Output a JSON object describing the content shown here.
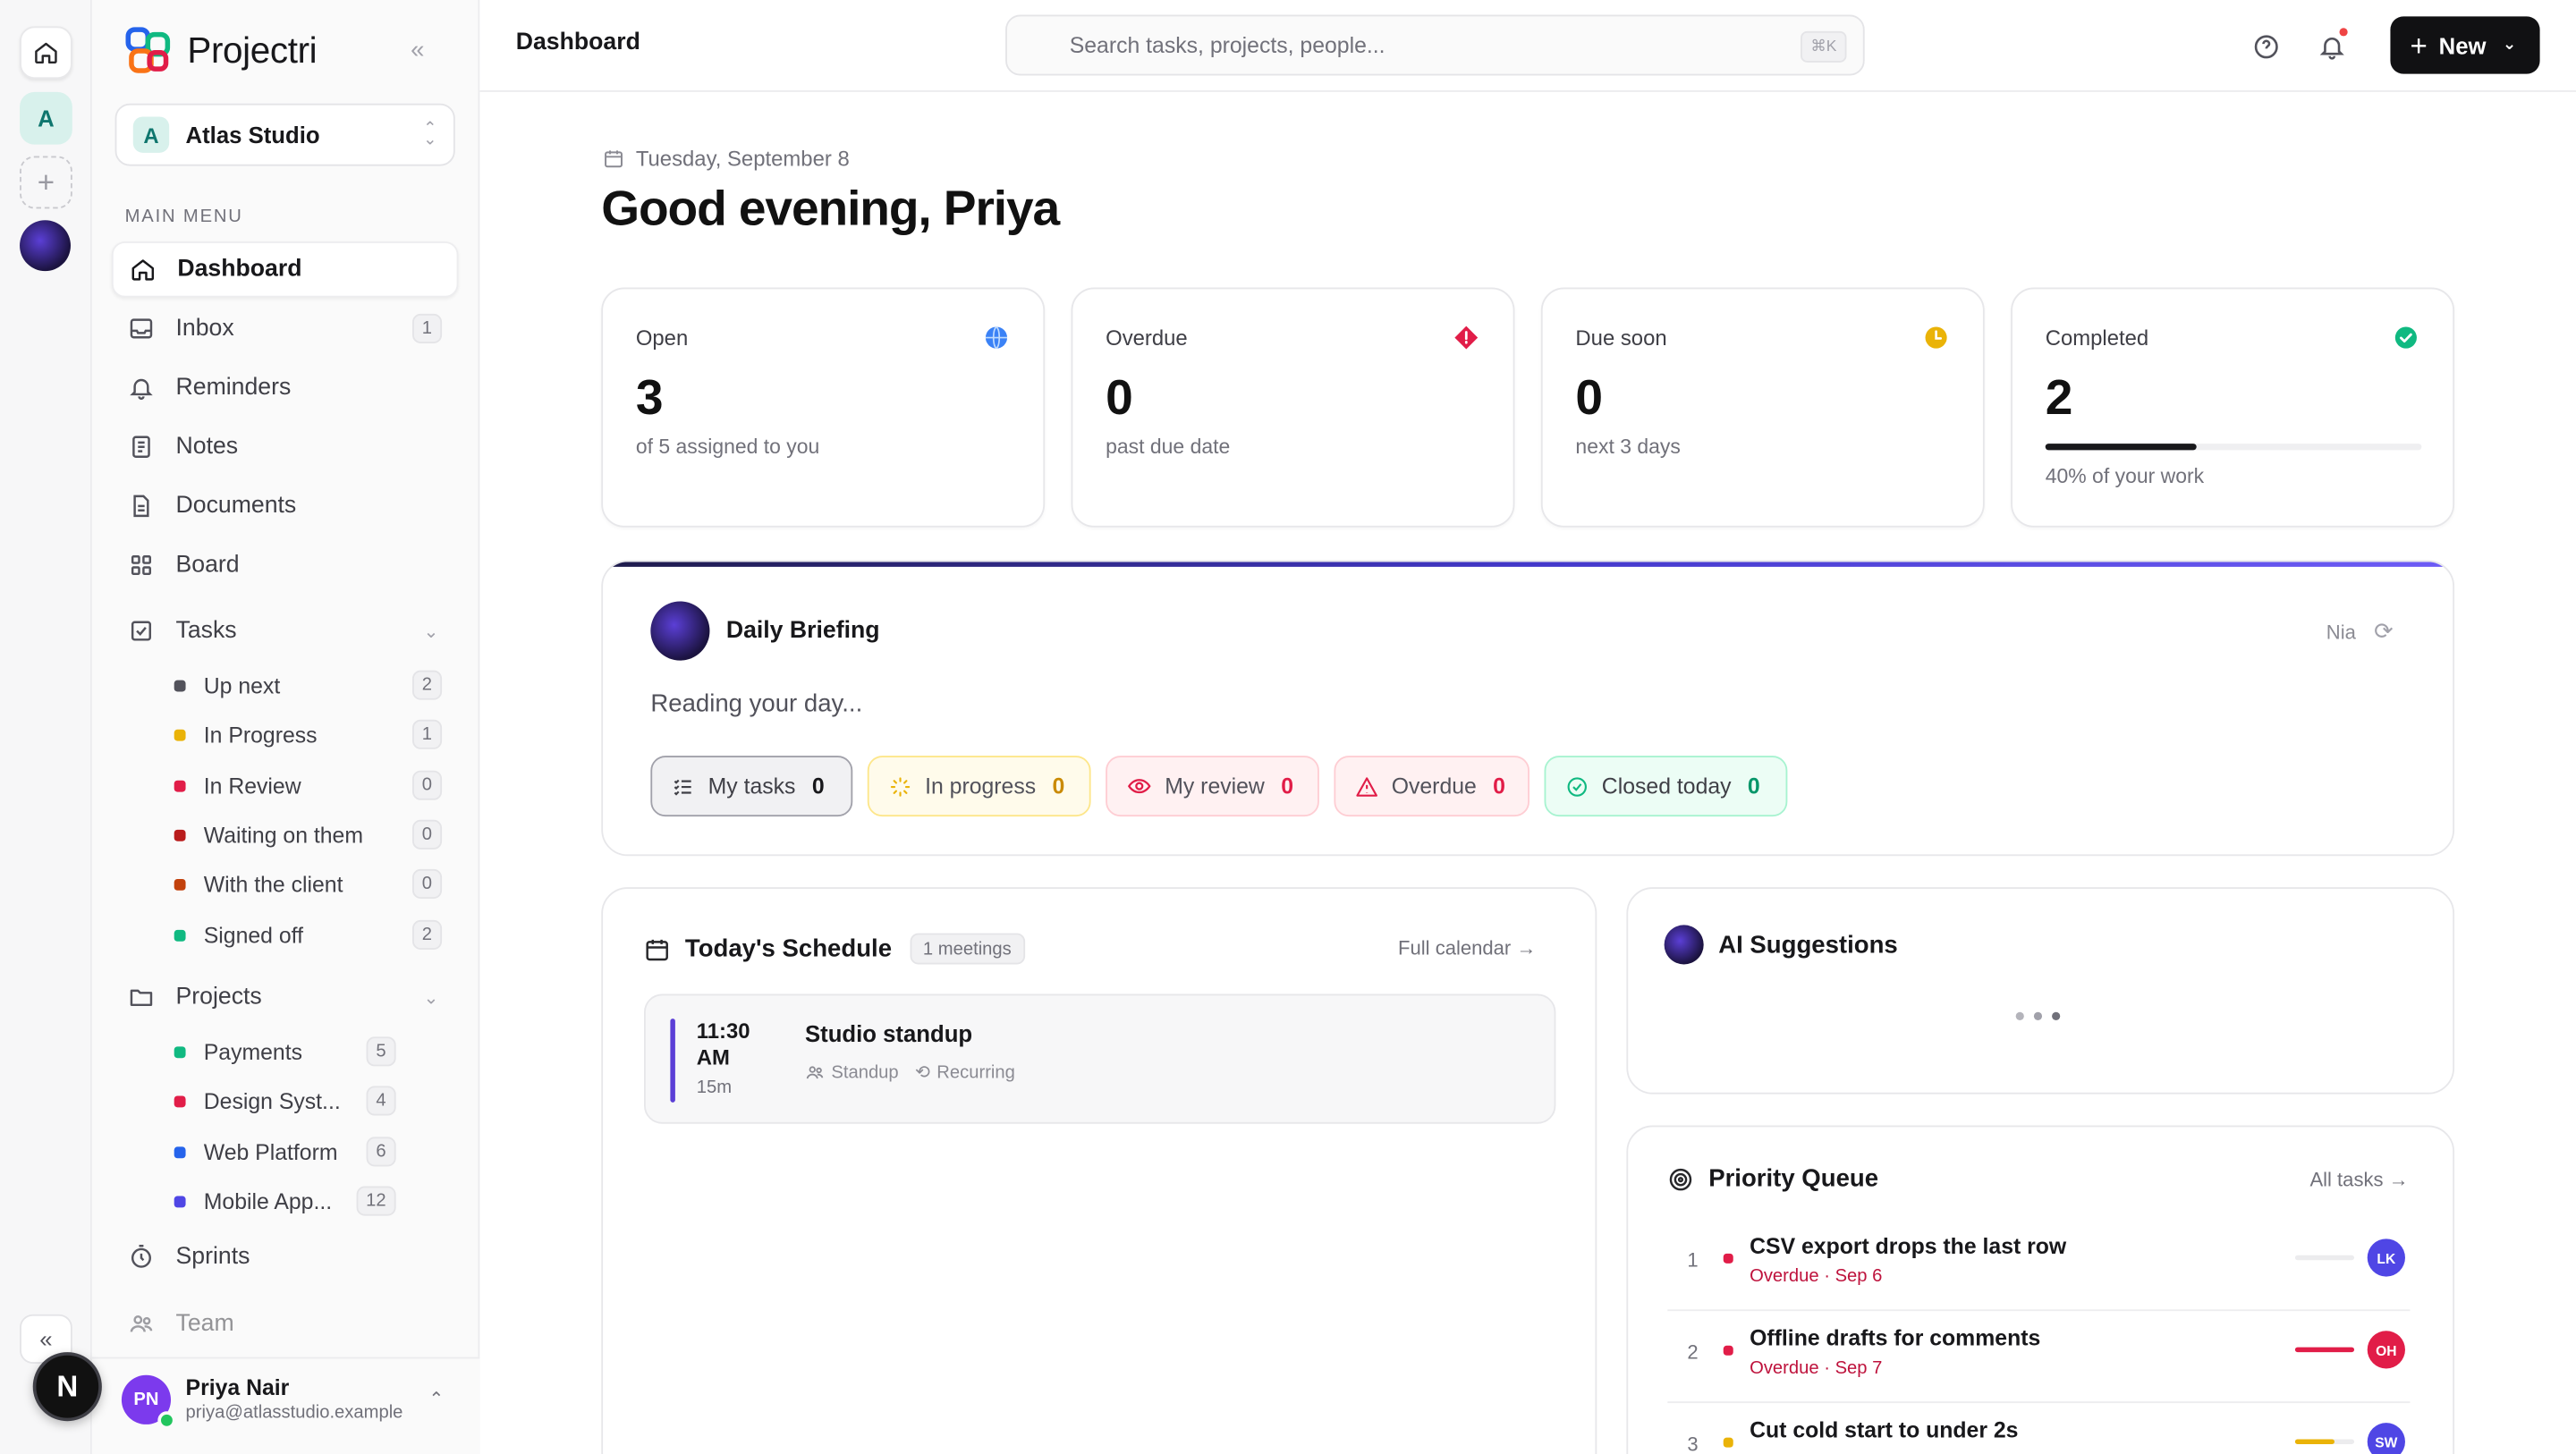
{
  "app": {
    "name": "Projectri"
  },
  "workspace": {
    "initial": "A",
    "name": "Atlas Studio"
  },
  "rail": {
    "workspace_initial": "A",
    "overlay_badge": "N"
  },
  "sidebar": {
    "section_label": "MAIN MENU",
    "items": [
      {
        "label": "Dashboard",
        "icon": "home-icon"
      },
      {
        "label": "Inbox",
        "icon": "inbox-icon",
        "count": "1"
      },
      {
        "label": "Reminders",
        "icon": "bell-icon"
      },
      {
        "label": "Notes",
        "icon": "notes-icon"
      },
      {
        "label": "Documents",
        "icon": "document-icon"
      },
      {
        "label": "Board",
        "icon": "board-icon"
      },
      {
        "label": "Tasks",
        "icon": "checkbox-icon"
      }
    ],
    "task_views": [
      {
        "label": "Up next",
        "count": "2",
        "color": "#52525b"
      },
      {
        "label": "In Progress",
        "count": "1",
        "color": "#eab308"
      },
      {
        "label": "In Review",
        "count": "0",
        "color": "#e11d48"
      },
      {
        "label": "Waiting on them",
        "count": "0",
        "color": "#b91c1c"
      },
      {
        "label": "With the client",
        "count": "0",
        "color": "#c2410c"
      },
      {
        "label": "Signed off",
        "count": "2",
        "color": "#10b981"
      }
    ],
    "projects_label": "Projects",
    "projects": [
      {
        "label": "Payments",
        "count": "5",
        "color": "#10b981"
      },
      {
        "label": "Design Syst...",
        "count": "4",
        "color": "#e11d48"
      },
      {
        "label": "Web Platform",
        "count": "6",
        "color": "#2563eb"
      },
      {
        "label": "Mobile App...",
        "count": "12",
        "color": "#4f46e5"
      }
    ],
    "sprints_label": "Sprints",
    "team_label": "Team"
  },
  "user": {
    "initials": "PN",
    "name": "Priya Nair",
    "email": "priya@atlasstudio.example"
  },
  "topbar": {
    "breadcrumb": "Dashboard",
    "search_placeholder": "Search tasks, projects, people...",
    "search_shortcut": "⌘K",
    "new_label": "New"
  },
  "header": {
    "date": "Tuesday, September 8",
    "greeting": "Good evening, Priya"
  },
  "stats": [
    {
      "label": "Open",
      "value": "3",
      "sub": "of 5 assigned to you",
      "color": "#3b82f6"
    },
    {
      "label": "Overdue",
      "value": "0",
      "sub": "past due date",
      "color": "#e11d48"
    },
    {
      "label": "Due soon",
      "value": "0",
      "sub": "next 3 days",
      "color": "#eab308"
    },
    {
      "label": "Completed",
      "value": "2",
      "sub": "40% of your work",
      "color": "#10b981",
      "progress": 0.4
    }
  ],
  "briefing": {
    "title": "Daily Briefing",
    "assistant": "Nia",
    "status_text": "Reading your day...",
    "chips": [
      {
        "label": "My tasks",
        "count": "0"
      },
      {
        "label": "In progress",
        "count": "0"
      },
      {
        "label": "My review",
        "count": "0"
      },
      {
        "label": "Overdue",
        "count": "0"
      },
      {
        "label": "Closed today",
        "count": "0"
      }
    ]
  },
  "schedule": {
    "title": "Today's Schedule",
    "meetings_count": "1 meetings",
    "full_calendar": "Full calendar →",
    "events": [
      {
        "time": "11:30 AM",
        "duration": "15m",
        "name": "Studio standup",
        "type": "Standup",
        "recurrence": "Recurring"
      }
    ]
  },
  "ai": {
    "title": "AI Suggestions"
  },
  "priority": {
    "title": "Priority Queue",
    "all_tasks": "All tasks →",
    "rows": [
      {
        "rank": "1",
        "name": "CSV export drops the last row",
        "sub": "Overdue · Sep 6",
        "assignee": "LK",
        "avatar_color": "#4f46e5",
        "bar_color": "#e4e4e7",
        "level": 0
      },
      {
        "rank": "2",
        "name": "Offline drafts for comments",
        "sub": "Overdue · Sep 7",
        "assignee": "OH",
        "avatar_color": "#e11d48",
        "bar_color": "#e11d48",
        "level": 1
      },
      {
        "rank": "3",
        "name": "Cut cold start to under 2s",
        "sub": "",
        "assignee": "SW",
        "avatar_color": "#4f46e5",
        "bar_color": "#eab308",
        "level": 0.66
      }
    ]
  }
}
